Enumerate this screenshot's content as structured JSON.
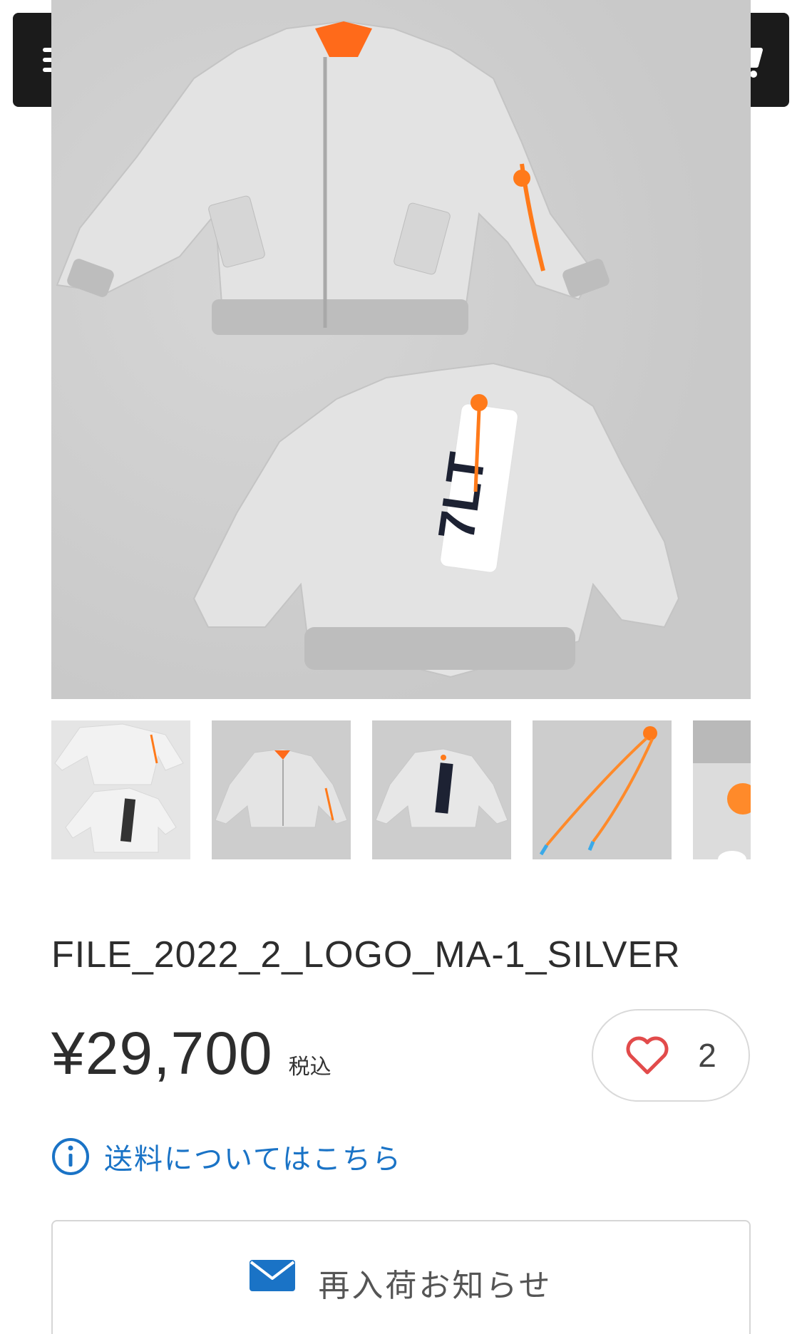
{
  "header": {
    "menu_icon": "hamburger-menu-icon",
    "cart_icon": "shopping-cart-icon"
  },
  "gallery": {
    "main_image": "silver MA-1 bomber jacket, front and back view",
    "thumbnails": [
      "jacket-front-and-back",
      "jacket-front",
      "jacket-back",
      "orange-cord-accessory",
      "jacket-detail"
    ]
  },
  "product": {
    "title": "FILE_2022_2_LOGO_MA-1_SILVER",
    "price": "¥29,700",
    "tax_label": "税込",
    "favorite_count": "2"
  },
  "shipping": {
    "link_text": "送料についてはこちら"
  },
  "restock": {
    "label": "再入荷お知らせ"
  },
  "colors": {
    "accent_blue": "#1a73c6",
    "heart_red": "#e24b4b",
    "header_btn": "#1b1b1b",
    "jacket_silver": "#e2e2e2",
    "cord_orange": "#ff7a1a"
  }
}
